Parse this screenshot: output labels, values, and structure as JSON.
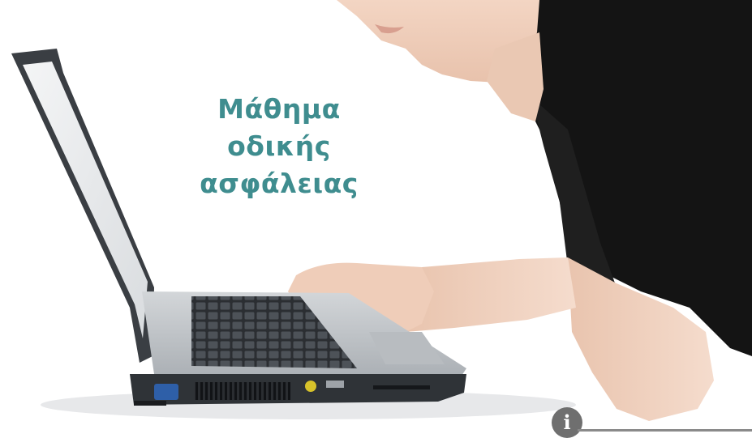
{
  "title": {
    "lines": [
      "Μάθημα",
      "οδικής",
      "ασφάλειας"
    ],
    "color": "#3f8d8f"
  },
  "info": {
    "icon": "info-icon",
    "glyph": "i"
  },
  "colors": {
    "background": "#ffffff",
    "shirt": "#141414",
    "skin": "#f2d3c1",
    "laptop_body": "#bfc4c8",
    "laptop_dark": "#3a3e43"
  }
}
